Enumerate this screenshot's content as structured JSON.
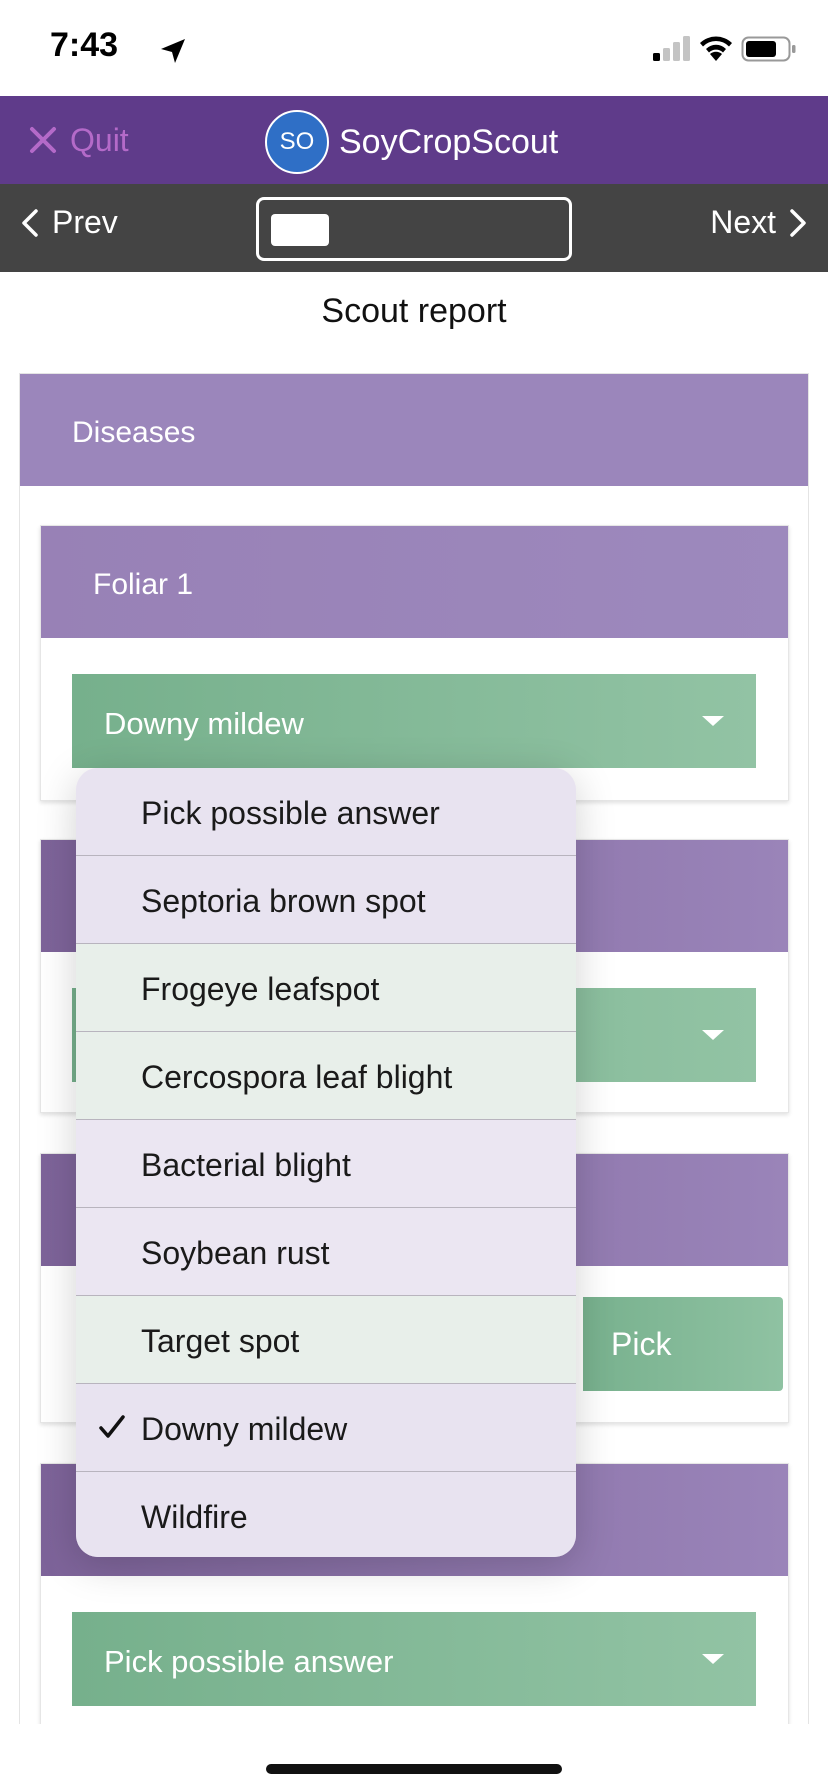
{
  "status_bar": {
    "time": "7:43",
    "icons": [
      "location-arrow-icon",
      "cellular-signal-icon",
      "wifi-icon",
      "battery-icon"
    ]
  },
  "header": {
    "quit_label": "Quit",
    "avatar_initials": "SO",
    "app_name": "SoyCropScout",
    "colors": {
      "header_bg": "#5f3b8a",
      "quit": "#b46ac9",
      "avatar": "#2f6fc6"
    }
  },
  "nav": {
    "prev_label": "Prev",
    "next_label": "Next"
  },
  "report": {
    "title": "Scout report",
    "section_title": "Diseases",
    "foliar1": {
      "title": "Foliar 1",
      "selected": "Downy mildew"
    },
    "pick_label": "Pick",
    "last_select_value": "Pick possible answer"
  },
  "dropdown": {
    "options": [
      {
        "label": "Pick possible answer",
        "checked": false
      },
      {
        "label": "Septoria brown spot",
        "checked": false
      },
      {
        "label": "Frogeye leafspot",
        "checked": false
      },
      {
        "label": "Cercospora leaf blight",
        "checked": false
      },
      {
        "label": "Bacterial blight",
        "checked": false
      },
      {
        "label": "Soybean rust",
        "checked": false
      },
      {
        "label": "Target spot",
        "checked": false
      },
      {
        "label": "Downy mildew",
        "checked": true
      },
      {
        "label": "Wildfire",
        "checked": false
      }
    ]
  },
  "colors": {
    "section_head": "#9b86bb",
    "select_green": "#76b08c",
    "nav_bg": "#444444"
  }
}
